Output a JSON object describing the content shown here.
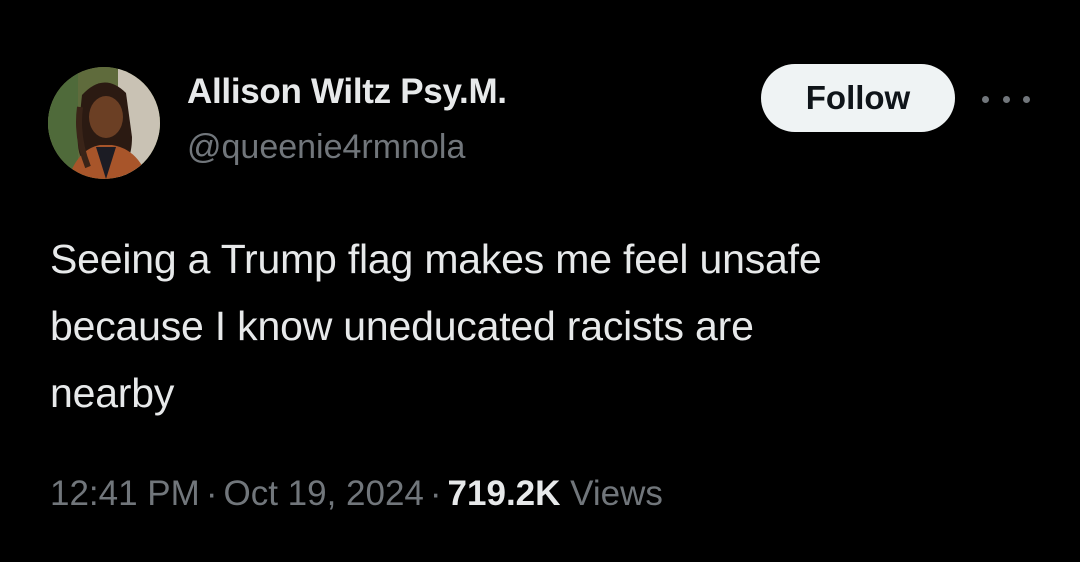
{
  "author": {
    "display_name": "Allison Wiltz Psy.M.",
    "handle": "@queenie4rmnola"
  },
  "actions": {
    "follow_label": "Follow",
    "more_icon": "more-horizontal-icon"
  },
  "tweet": {
    "text_lines": [
      "Seeing a Trump flag makes me feel unsafe",
      "because I know uneducated racists are",
      "nearby"
    ],
    "time": "12:41 PM",
    "date": "Oct 19, 2024",
    "separator": "·",
    "views_count": "719.2K",
    "views_label": "Views"
  },
  "colors": {
    "background": "#000000",
    "primary_text": "#e7e9ea",
    "secondary_text": "#71767b",
    "follow_bg": "#eff3f4",
    "follow_text": "#0f1419"
  }
}
